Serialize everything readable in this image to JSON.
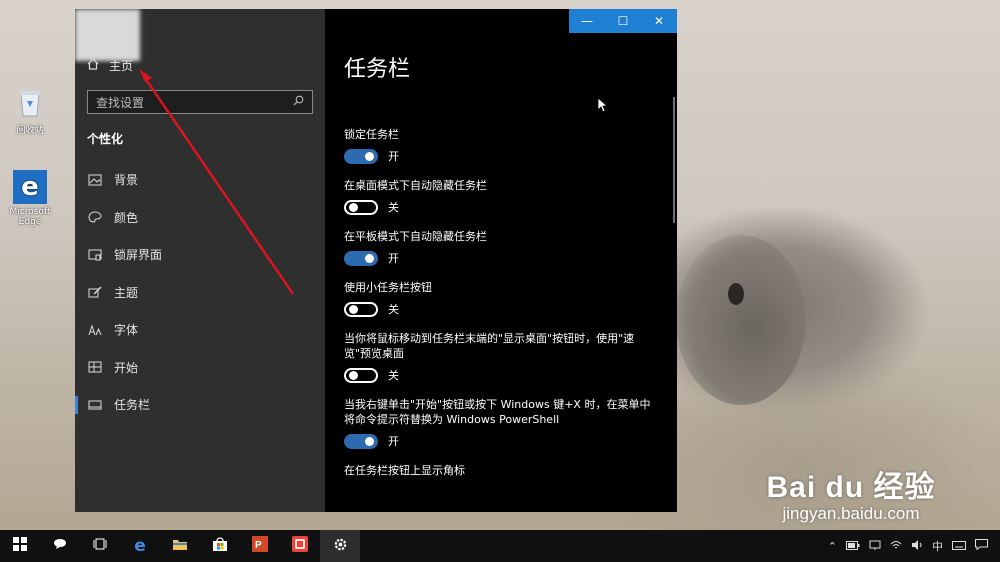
{
  "desktop": {
    "icons": [
      {
        "label": "回收站",
        "icon": "recycle-bin-icon"
      },
      {
        "label": "Microsoft Edge",
        "icon": "edge-icon"
      }
    ]
  },
  "window": {
    "title_buttons": {
      "minimize": "—",
      "maximize": "☐",
      "close": "✕"
    },
    "sidebar": {
      "home_label": "主页",
      "search_placeholder": "查找设置",
      "section_title": "个性化",
      "items": [
        {
          "label": "背景",
          "icon": "picture-icon",
          "active": false
        },
        {
          "label": "颜色",
          "icon": "palette-icon",
          "active": false
        },
        {
          "label": "锁屏界面",
          "icon": "lock-screen-icon",
          "active": false
        },
        {
          "label": "主题",
          "icon": "theme-brush-icon",
          "active": false
        },
        {
          "label": "字体",
          "icon": "font-icon",
          "active": false
        },
        {
          "label": "开始",
          "icon": "start-menu-icon",
          "active": false
        },
        {
          "label": "任务栏",
          "icon": "taskbar-icon",
          "active": true
        }
      ]
    },
    "content": {
      "page_title": "任务栏",
      "settings": [
        {
          "label": "锁定任务栏",
          "state": "on",
          "state_label": "开"
        },
        {
          "label": "在桌面模式下自动隐藏任务栏",
          "state": "off",
          "state_label": "关"
        },
        {
          "label": "在平板模式下自动隐藏任务栏",
          "state": "on",
          "state_label": "开"
        },
        {
          "label": "使用小任务栏按钮",
          "state": "off",
          "state_label": "关"
        },
        {
          "label": "当你将鼠标移动到任务栏末端的\"显示桌面\"按钮时，使用\"速览\"预览桌面",
          "state": "off",
          "state_label": "关"
        },
        {
          "label": "当我右键单击\"开始\"按钮或按下 Windows 键+X 时，在菜单中将命令提示符替换为 Windows PowerShell",
          "state": "on",
          "state_label": "开"
        },
        {
          "label": "在任务栏按钮上显示角标",
          "state": "on",
          "state_label": ""
        }
      ]
    }
  },
  "taskbar": {
    "items": [
      {
        "name": "start-button",
        "icon": "windows-logo-icon",
        "active": false
      },
      {
        "name": "cortana-button",
        "icon": "cortana-icon",
        "active": false
      },
      {
        "name": "task-view-button",
        "icon": "task-view-icon",
        "active": false
      },
      {
        "name": "edge-taskbar-button",
        "icon": "edge-icon",
        "active": false
      },
      {
        "name": "file-explorer-button",
        "icon": "folder-icon",
        "active": false
      },
      {
        "name": "store-button",
        "icon": "store-bag-icon",
        "active": false
      },
      {
        "name": "powerpoint-button",
        "icon": "powerpoint-icon",
        "active": false
      },
      {
        "name": "recorder-button",
        "icon": "recorder-icon",
        "active": false
      },
      {
        "name": "settings-taskbar-button",
        "icon": "gear-icon",
        "active": true
      }
    ],
    "tray": {
      "ime": "中"
    }
  },
  "watermark": {
    "brand": "Bai du 经验",
    "url": "jingyan.baidu.com"
  },
  "colors": {
    "accent": "#1f7fd3",
    "toggle_on": "#2d6bb0",
    "annotation_arrow": "#e0141e"
  }
}
